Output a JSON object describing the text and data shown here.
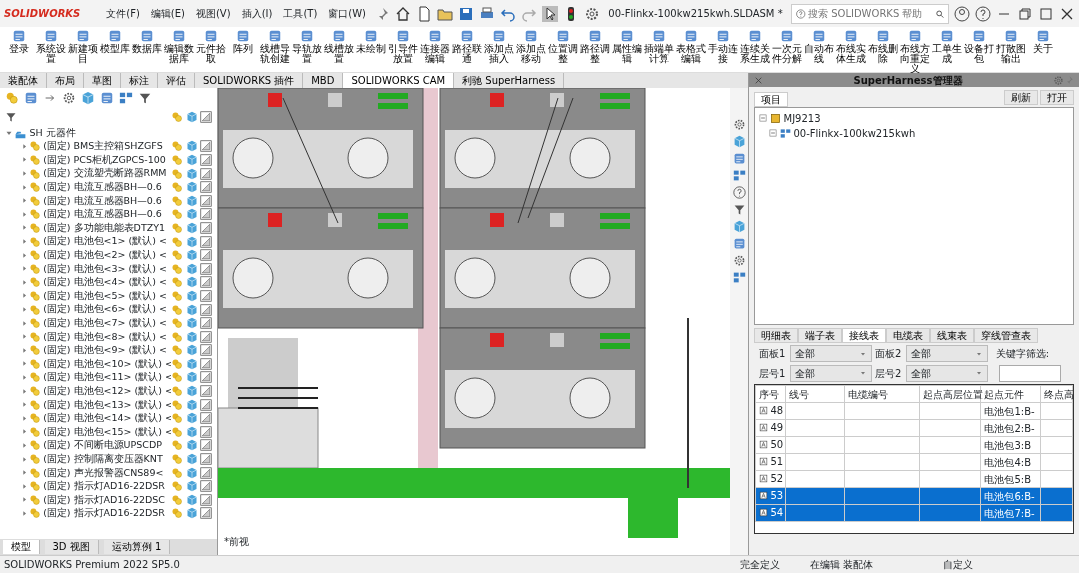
{
  "window": {
    "title": "00-Flinkx-100kw215kwh.SLDASM *",
    "logo": "SOLIDWORKS",
    "menu": [
      "文件(F)",
      "编辑(E)",
      "视图(V)",
      "插入(I)",
      "工具(T)",
      "窗口(W)"
    ],
    "search": {
      "placeholder": "搜索 SOLIDWORKS 帮助"
    }
  },
  "ribbon": [
    "登录",
    "系统设置",
    "新建项目",
    "模型库",
    "数据库",
    "编辑数据库",
    "元件拾取",
    "阵列",
    "线槽导轨创建",
    "导轨放置",
    "线槽放置",
    "未绘制",
    "引导件放置",
    "连接器编辑",
    "路径联通",
    "添加点插入",
    "添加点移动",
    "位置调整",
    "路径调整",
    "属性编辑",
    "插端单计算",
    "表格式编辑",
    "手动连接",
    "连续关系生成",
    "一次元件分解",
    "自动布线",
    "布线实体生成",
    "布线删除",
    "布线方向重定义",
    "工单生成",
    "设备打包",
    "打散图输出",
    "关于"
  ],
  "tabs": [
    {
      "label": "装配体",
      "selected": false
    },
    {
      "label": "布局",
      "selected": false
    },
    {
      "label": "草图",
      "selected": false
    },
    {
      "label": "标注",
      "selected": false
    },
    {
      "label": "评估",
      "selected": false
    },
    {
      "label": "SOLIDWORKS 插件",
      "selected": false
    },
    {
      "label": "MBD",
      "selected": false
    },
    {
      "label": "SOLIDWORKS CAM",
      "selected": true
    },
    {
      "label": "利驰 SuperHarness",
      "selected": false
    }
  ],
  "tree": {
    "label": "SH 元器件",
    "expanded": true,
    "children": [
      {
        "label": "(固定) BMS主控箱SHZGFS",
        "expanded": false
      },
      {
        "label": "(固定) PCS柜机ZGPCS-100",
        "expanded": false
      },
      {
        "label": "(固定) 交流塑壳断路器RMM",
        "expanded": false
      },
      {
        "label": "(固定) 电流互感器BH—0.6",
        "expanded": false
      },
      {
        "label": "(固定) 电流互感器BH—0.6",
        "expanded": false
      },
      {
        "label": "(固定) 电流互感器BH—0.6",
        "expanded": false
      },
      {
        "label": "(固定) 多功能电能表DTZY1",
        "expanded": false
      },
      {
        "label": "(固定) 电池包<1> (默认) <",
        "expanded": false
      },
      {
        "label": "(固定) 电池包<2> (默认) <",
        "expanded": false
      },
      {
        "label": "(固定) 电池包<3> (默认) <",
        "expanded": false
      },
      {
        "label": "(固定) 电池包<4> (默认) <",
        "expanded": false
      },
      {
        "label": "(固定) 电池包<5> (默认) <",
        "expanded": false
      },
      {
        "label": "(固定) 电池包<6> (默认) <",
        "expanded": false
      },
      {
        "label": "(固定) 电池包<7> (默认) <",
        "expanded": false
      },
      {
        "label": "(固定) 电池包<8> (默认) <",
        "expanded": false
      },
      {
        "label": "(固定) 电池包<9> (默认) <",
        "expanded": false
      },
      {
        "label": "(固定) 电池包<10> (默认) <",
        "expanded": false
      },
      {
        "label": "(固定) 电池包<11> (默认) <",
        "expanded": false
      },
      {
        "label": "(固定) 电池包<12> (默认) <",
        "expanded": false
      },
      {
        "label": "(固定) 电池包<13> (默认) <",
        "expanded": false
      },
      {
        "label": "(固定) 电池包<14> (默认) <",
        "expanded": false
      },
      {
        "label": "(固定) 电池包<15> (默认) <",
        "expanded": false
      },
      {
        "label": "(固定) 不间断电源UPSCDP",
        "expanded": false
      },
      {
        "label": "(固定) 控制隔离变压器KNT",
        "expanded": false
      },
      {
        "label": "(固定) 声光报警器CNS89<",
        "expanded": false
      },
      {
        "label": "(固定) 指示灯AD16-22DSR",
        "expanded": false
      },
      {
        "label": "(固定) 指示灯AD16-22DSC",
        "expanded": false
      },
      {
        "label": "(固定) 指示灯AD16-22DSR",
        "expanded": false
      }
    ]
  },
  "bottom_tabs": [
    {
      "label": "模型",
      "selected": true
    },
    {
      "label": "3D 视图",
      "selected": false
    },
    {
      "label": "运动算例 1",
      "selected": false
    }
  ],
  "view_label": "*前视",
  "manager": {
    "title": "SuperHarness管理器",
    "tab": "项目",
    "buttons": [
      "刷新",
      "打开"
    ],
    "tree": {
      "label": "MJ9213",
      "expanded": true,
      "children": [
        {
          "label": "00-Flinkx-100kw215kwh",
          "expanded": true
        }
      ]
    },
    "table_tabs": [
      {
        "label": "明细表",
        "selected": false
      },
      {
        "label": "端子表",
        "selected": false
      },
      {
        "label": "接线表",
        "selected": true
      },
      {
        "label": "电缆表",
        "selected": false
      },
      {
        "label": "线束表",
        "selected": false
      },
      {
        "label": "穿线管查表",
        "selected": false
      }
    ],
    "filters": [
      {
        "label": "面板1",
        "value": "全部"
      },
      {
        "label": "面板2",
        "value": "全部"
      },
      {
        "label": "层号1",
        "value": "全部"
      },
      {
        "label": "层号2",
        "value": "全部"
      }
    ],
    "keyword": {
      "label": "关键字筛选:"
    },
    "columns": [
      "序号",
      "线号",
      "电缆编号",
      "起点高层位置",
      "起点元件",
      "终点高"
    ],
    "rows": [
      {
        "no": "48",
        "start": "电池包1:B-",
        "selected": false
      },
      {
        "no": "49",
        "start": "电池包2:B-",
        "selected": false
      },
      {
        "no": "50",
        "start": "电池包3:B",
        "selected": false
      },
      {
        "no": "51",
        "start": "电池包4:B",
        "selected": false
      },
      {
        "no": "52",
        "start": "电池包5:B",
        "selected": false
      },
      {
        "no": "53",
        "start": "电池包6:B-",
        "selected": true
      },
      {
        "no": "54",
        "start": "电池包7:B-",
        "selected": true
      }
    ]
  },
  "status_bar": {
    "product": "SOLIDWORKS Premium 2022 SP5.0",
    "state": "完全定义",
    "mode": "在编辑 装配体",
    "units": "自定义"
  }
}
